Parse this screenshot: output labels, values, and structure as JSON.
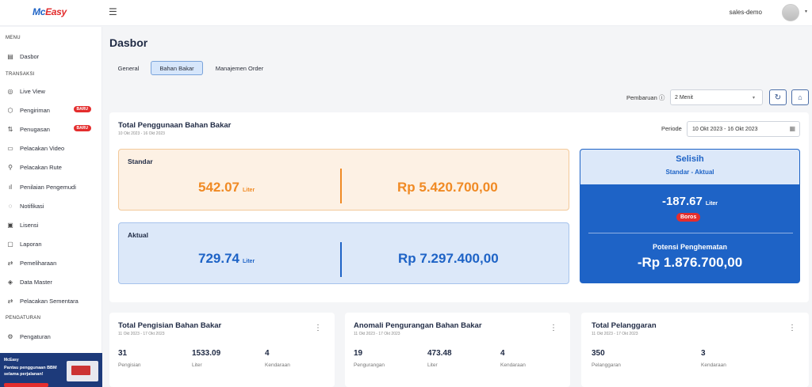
{
  "topbar": {
    "logo_mc": "Mc",
    "logo_easy": "Easy",
    "menu_icon": "hamburger-icon",
    "username": "sales-demo",
    "avatar_icon": "user-avatar-icon"
  },
  "sidebar": {
    "menu_label": "MENU",
    "transaksi_label": "TRANSAKSI",
    "pengaturan_label": "PENGATURAN",
    "items": [
      {
        "label": "Dasbor",
        "icon": "dashboard-icon",
        "glyph": "▤"
      },
      {
        "label": "Live View",
        "icon": "live-view-icon",
        "glyph": "◎"
      },
      {
        "label": "Pengiriman",
        "icon": "box-icon",
        "glyph": "⬡",
        "badge": "BARU"
      },
      {
        "label": "Penugasan",
        "icon": "assignment-icon",
        "glyph": "⇅",
        "badge": "BARU"
      },
      {
        "label": "Pelacakan Video",
        "icon": "video-icon",
        "glyph": "▭"
      },
      {
        "label": "Pelacakan Rute",
        "icon": "route-icon",
        "glyph": "⚲"
      },
      {
        "label": "Penilaian Pengemudi",
        "icon": "bar-chart-icon",
        "glyph": "ıl"
      },
      {
        "label": "Notifikasi",
        "icon": "bell-icon",
        "glyph": "◌"
      },
      {
        "label": "Lisensi",
        "icon": "license-icon",
        "glyph": "▣"
      },
      {
        "label": "Laporan",
        "icon": "report-icon",
        "glyph": "▢"
      },
      {
        "label": "Pemeliharaan",
        "icon": "maintenance-icon",
        "glyph": "⇄"
      },
      {
        "label": "Data Master",
        "icon": "database-icon",
        "glyph": "◈"
      },
      {
        "label": "Pelacakan Sementara",
        "icon": "temporary-tracking-icon",
        "glyph": "⇄"
      },
      {
        "label": "Pengaturan",
        "icon": "gear-icon",
        "glyph": "⚙"
      }
    ],
    "promo": {
      "logo": "McEasy",
      "text": "Pantau penggunaan BBM selama perjalanan!"
    }
  },
  "main": {
    "title": "Dasbor",
    "tabs": [
      {
        "label": "General"
      },
      {
        "label": "Bahan Bakar",
        "active": true
      },
      {
        "label": "Manajemen Order"
      }
    ],
    "refresh": {
      "label": "Pembaruan ⓘ",
      "selected": "2 Menit"
    }
  },
  "fuel": {
    "title": "Total Penggunaan Bahan Bakar",
    "date_range": "10 Okt 2023 - 16 Okt 2023",
    "periode_label": "Periode",
    "periode_value": "10 Okt 2023 - 16 Okt 2023",
    "standar": {
      "label": "Standar",
      "liter": "542.07",
      "unit": "Liter",
      "rupiah": "Rp 5.420.700,00"
    },
    "aktual": {
      "label": "Aktual",
      "liter": "729.74",
      "unit": "Liter",
      "rupiah": "Rp 7.297.400,00"
    },
    "selisih": {
      "title": "Selisih",
      "subtitle": "Standar - Aktual",
      "value": "-187.67",
      "unit": "Liter",
      "badge": "Boros",
      "potensi_label": "Potensi Penghematan",
      "potensi_value": "-Rp 1.876.700,00"
    }
  },
  "bottom_cards": [
    {
      "title": "Total Pengisian Bahan Bakar",
      "date_range": "11 Okt 2023 - 17 Okt 2023",
      "stats": [
        {
          "value": "31",
          "label": "Pengisian"
        },
        {
          "value": "1533.09",
          "label": "Liter"
        },
        {
          "value": "4",
          "label": "Kendaraan"
        }
      ]
    },
    {
      "title": "Anomali Pengurangan Bahan Bakar",
      "date_range": "11 Okt 2023 - 17 Okt 2023",
      "stats": [
        {
          "value": "19",
          "label": "Pengurangan"
        },
        {
          "value": "473.48",
          "label": "Liter"
        },
        {
          "value": "4",
          "label": "Kendaraan"
        }
      ]
    },
    {
      "title": "Total Pelanggaran",
      "date_range": "11 Okt 2023 - 17 Okt 2023",
      "stats": [
        {
          "value": "350",
          "label": "Pelanggaran"
        },
        {
          "value": "3",
          "label": "Kendaraan"
        }
      ]
    }
  ],
  "colors": {
    "brand_blue": "#1e63c6",
    "brand_red": "#e22a2a",
    "standar_orange": "#f08a24",
    "aktual_blue": "#1e63c6"
  }
}
